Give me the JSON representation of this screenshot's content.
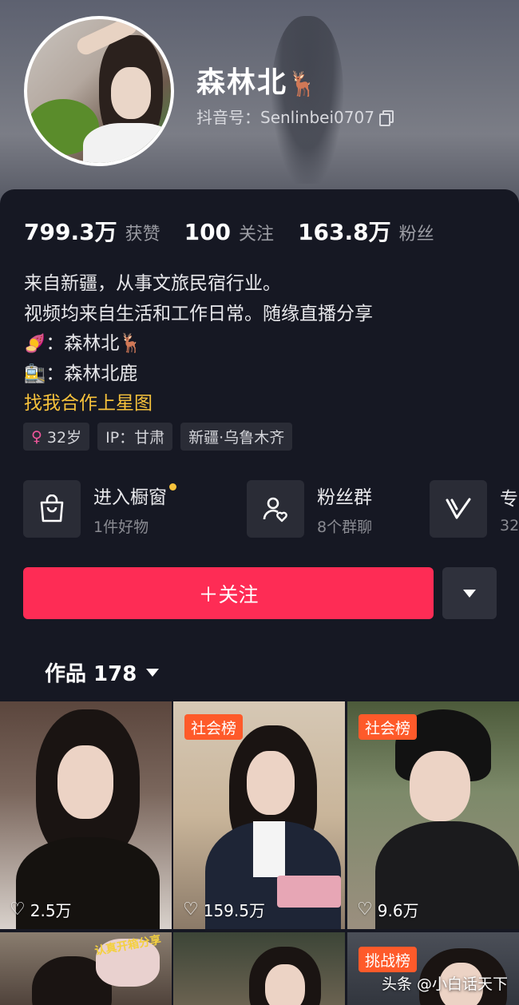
{
  "profile": {
    "username": "森林北",
    "username_emoji": "🦌",
    "douyin_id": "抖音号：Senlinbei0707"
  },
  "stats": [
    {
      "value": "799.3万",
      "label": "获赞"
    },
    {
      "value": "100",
      "label": "关注"
    },
    {
      "value": "163.8万",
      "label": "粉丝"
    }
  ],
  "bio": {
    "line1": "来自新疆，从事文旅民宿行业。",
    "line2": "视频均来自生活和工作日常。随缘直播分享",
    "line3_emoji": "🍠",
    "line3_text": "：森林北🦌",
    "line4_emoji": "🚉",
    "line4_text": "：森林北鹿",
    "link": "找我合作上星图"
  },
  "tags": {
    "age": "32岁",
    "ip": "IP：甘肃",
    "location": "新疆·乌鲁木齐"
  },
  "shortcuts": [
    {
      "title": "进入橱窗",
      "sub": "1件好物",
      "icon": "shopping-bag-icon"
    },
    {
      "title": "粉丝群",
      "sub": "8个群聊",
      "icon": "fan-group-icon"
    },
    {
      "title": "专",
      "sub": "32",
      "icon": "v-badge-icon"
    }
  ],
  "follow_label": "＋关注",
  "works_label": "作品 178",
  "videos": [
    {
      "likes": "2.5万",
      "label": ""
    },
    {
      "likes": "159.5万",
      "label": "社会榜"
    },
    {
      "likes": "9.6万",
      "label": "社会榜"
    },
    {
      "likes": "",
      "label": ""
    },
    {
      "likes": "",
      "label": ""
    },
    {
      "likes": "",
      "label": "挑战榜"
    }
  ],
  "overlay_texts": {
    "sticker": "认真开箱分享"
  },
  "watermark": "头条 @小白话天下",
  "colors": {
    "accent_red": "#fe2c55",
    "link_yellow": "#f7c23b",
    "background": "#161823",
    "badge_orange": "#fe5a2a"
  }
}
